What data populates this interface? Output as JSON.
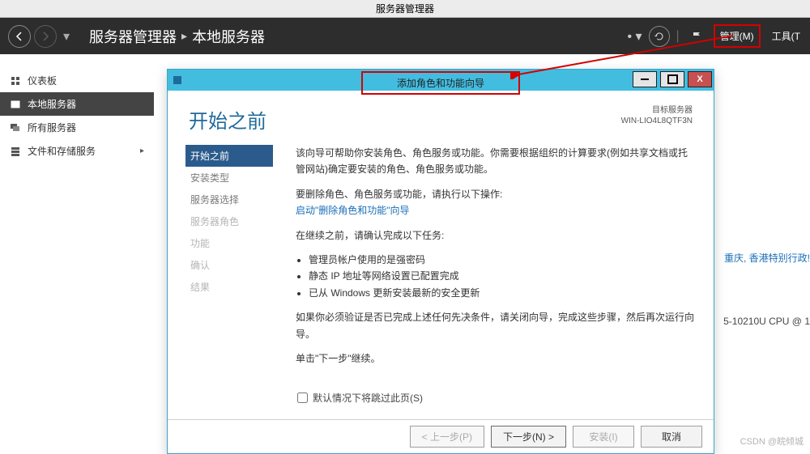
{
  "outer_title": "服务器管理器",
  "header": {
    "breadcrumb_root": "服务器管理器",
    "breadcrumb_current": "本地服务器",
    "manage": "管理(M)",
    "tools": "工具(T"
  },
  "sidebar": {
    "items": [
      {
        "label": "仪表板"
      },
      {
        "label": "本地服务器"
      },
      {
        "label": "所有服务器"
      },
      {
        "label": "文件和存储服务"
      }
    ]
  },
  "bg": {
    "hint1": "重庆, 香港特别行政!",
    "hint2": "5-10210U CPU @ 1"
  },
  "wizard": {
    "title": "添加角色和功能向导",
    "heading": "开始之前",
    "target_label": "目标服务器",
    "target_server": "WIN-LIO4L8QTF3N",
    "nav": [
      {
        "label": "开始之前",
        "state": "active"
      },
      {
        "label": "安装类型",
        "state": ""
      },
      {
        "label": "服务器选择",
        "state": ""
      },
      {
        "label": "服务器角色",
        "state": "disabled"
      },
      {
        "label": "功能",
        "state": "disabled"
      },
      {
        "label": "确认",
        "state": "disabled"
      },
      {
        "label": "结果",
        "state": "disabled"
      }
    ],
    "para1": "该向导可帮助你安装角色、角色服务或功能。你需要根据组织的计算要求(例如共享文档或托管网站)确定要安装的角色、角色服务或功能。",
    "para2_prefix": "要删除角色、角色服务或功能，请执行以下操作:",
    "para2_link": "启动\"删除角色和功能\"向导",
    "para3": "在继续之前，请确认完成以下任务:",
    "bullets": [
      "管理员帐户使用的是强密码",
      "静态 IP 地址等网络设置已配置完成",
      "已从 Windows 更新安装最新的安全更新"
    ],
    "para4": "如果你必须验证是否已完成上述任何先决条件，请关闭向导，完成这些步骤，然后再次运行向导。",
    "para5": "单击\"下一步\"继续。",
    "skip_checkbox": "默认情况下将跳过此页(S)",
    "buttons": {
      "prev": "< 上一步(P)",
      "next": "下一步(N) >",
      "install": "安装(I)",
      "cancel": "取消"
    }
  },
  "watermark": "CSDN @皖倾城"
}
